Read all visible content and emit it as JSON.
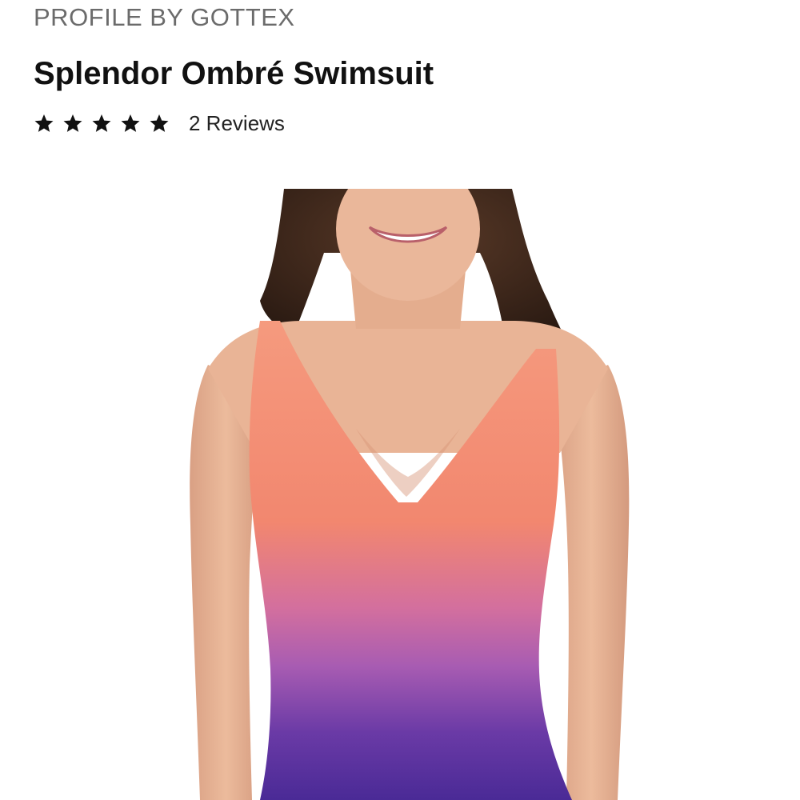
{
  "product": {
    "brand": "PROFILE BY GOTTEX",
    "name": "Splendor Ombré Swimsuit",
    "rating": {
      "stars": 5,
      "max_stars": 5,
      "reviews_label": "2 Reviews"
    },
    "image": {
      "description_icon": "product-photo"
    }
  },
  "colors": {
    "brand_text": "#6b6b6b",
    "title_text": "#111111",
    "star": "#111111",
    "ombre_top": "#f4907a",
    "ombre_mid": "#c86aae",
    "ombre_bottom": "#4a2a98",
    "skin": "#e8b294",
    "hair": "#3a2418"
  }
}
